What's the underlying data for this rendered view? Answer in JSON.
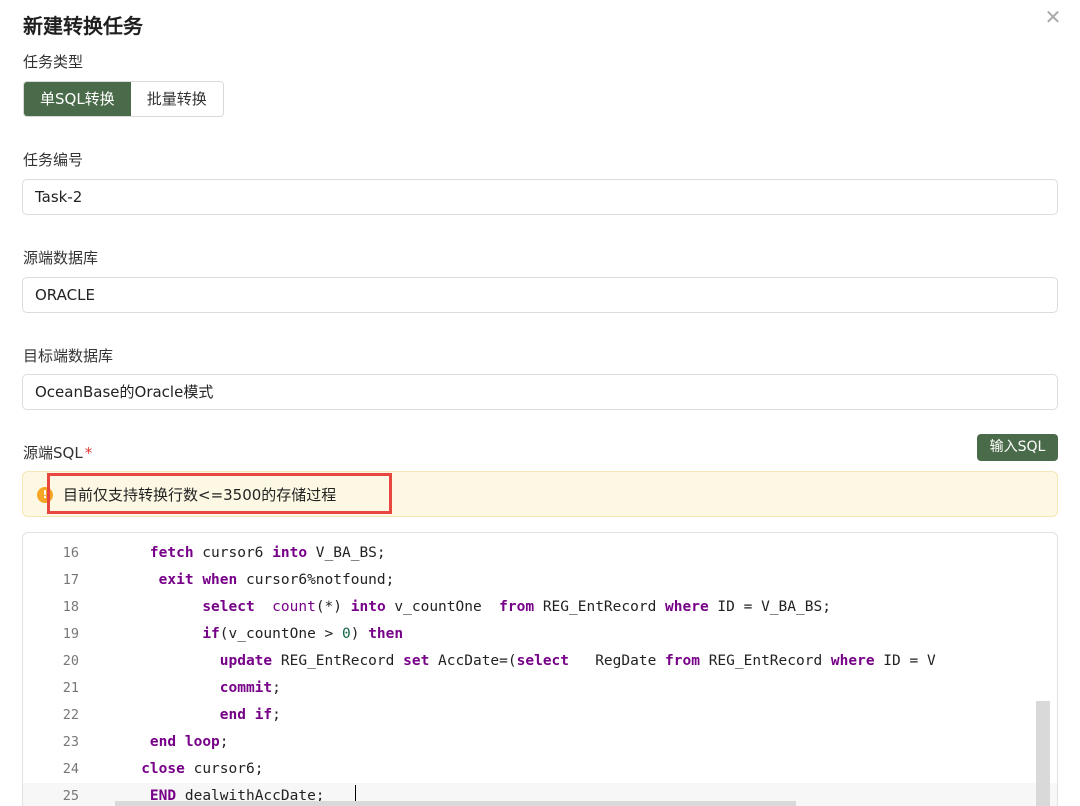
{
  "dialog": {
    "title": "新建转换任务",
    "close_icon": "close-icon"
  },
  "task_type": {
    "label": "任务类型",
    "options": [
      "单SQL转换",
      "批量转换"
    ],
    "selected": "单SQL转换"
  },
  "task_id": {
    "label": "任务编号",
    "value": "Task-2"
  },
  "source_db": {
    "label": "源端数据库",
    "value": "ORACLE"
  },
  "target_db": {
    "label": "目标端数据库",
    "value": "OceanBase的Oracle模式"
  },
  "source_sql": {
    "label": "源端SQL",
    "required_mark": "*",
    "input_button": "输入SQL",
    "notice": "目前仅支持转换行数<=3500的存储过程",
    "notice_icon": "warning-icon",
    "lines": [
      {
        "n": "16",
        "code": "    fetch cursor6 into V_BA_BS;"
      },
      {
        "n": "17",
        "code": "     exit when cursor6%notfound;"
      },
      {
        "n": "18",
        "code": "          select  count(*) into v_countOne  from REG_EntRecord where ID = V_BA_BS;"
      },
      {
        "n": "19",
        "code": "          if(v_countOne > 0) then"
      },
      {
        "n": "20",
        "code": "            update REG_EntRecord set AccDate=(select   RegDate from REG_EntRecord where ID = V"
      },
      {
        "n": "21",
        "code": "            commit;"
      },
      {
        "n": "22",
        "code": "            end if;"
      },
      {
        "n": "23",
        "code": "    end loop;"
      },
      {
        "n": "24",
        "code": "   close cursor6;"
      },
      {
        "n": "25",
        "code": "    END dealwithAccDate;"
      }
    ],
    "current_line": "25"
  },
  "colors": {
    "accent": "#4a6b4a",
    "warning": "#f5a623",
    "notice_bg": "#fdf8e3",
    "highlight_border": "#e8473f",
    "keyword": "#770088"
  }
}
